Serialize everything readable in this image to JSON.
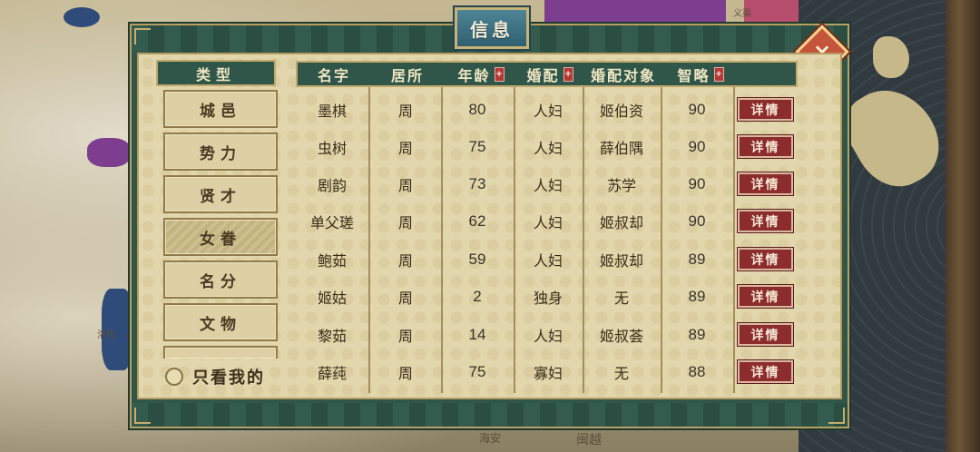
{
  "dialog": {
    "title": "信息",
    "close_label": "×"
  },
  "categories": {
    "header": "类型",
    "items": [
      {
        "label": "城邑",
        "active": false
      },
      {
        "label": "势力",
        "active": false
      },
      {
        "label": "贤才",
        "active": false
      },
      {
        "label": "女眷",
        "active": true
      },
      {
        "label": "名分",
        "active": false
      },
      {
        "label": "文物",
        "active": false
      }
    ],
    "only_mine_label": "只看我的"
  },
  "table": {
    "columns": [
      "名字",
      "居所",
      "年龄",
      "婚配",
      "婚配对象",
      "智略"
    ],
    "sort_marker": "+",
    "detail_label": "详情",
    "rows": [
      {
        "name": "墨棋",
        "residence": "周",
        "age": "80",
        "marriage": "人妇",
        "spouse": "姬伯资",
        "wisdom": "90"
      },
      {
        "name": "虫树",
        "residence": "周",
        "age": "75",
        "marriage": "人妇",
        "spouse": "薛伯隅",
        "wisdom": "90"
      },
      {
        "name": "剧韵",
        "residence": "周",
        "age": "73",
        "marriage": "人妇",
        "spouse": "苏学",
        "wisdom": "90"
      },
      {
        "name": "单父瑳",
        "residence": "周",
        "age": "62",
        "marriage": "人妇",
        "spouse": "姬叔却",
        "wisdom": "90"
      },
      {
        "name": "鲍茹",
        "residence": "周",
        "age": "59",
        "marriage": "人妇",
        "spouse": "姬叔却",
        "wisdom": "89"
      },
      {
        "name": "姬姑",
        "residence": "周",
        "age": "2",
        "marriage": "独身",
        "spouse": "无",
        "wisdom": "89"
      },
      {
        "name": "黎茹",
        "residence": "周",
        "age": "14",
        "marriage": "人妇",
        "spouse": "姬叔荟",
        "wisdom": "89"
      },
      {
        "name": "薛莼",
        "residence": "周",
        "age": "75",
        "marriage": "寡妇",
        "spouse": "无",
        "wisdom": "88"
      }
    ]
  },
  "map": {
    "labels": [
      "义渠",
      "洛阳",
      "闽越",
      "海安"
    ]
  },
  "colors": {
    "header_bg": "#2f5648",
    "panel_bg": "#e2d7ac",
    "detail_button": "#8c2c2c",
    "close_button": "#c5553a"
  }
}
